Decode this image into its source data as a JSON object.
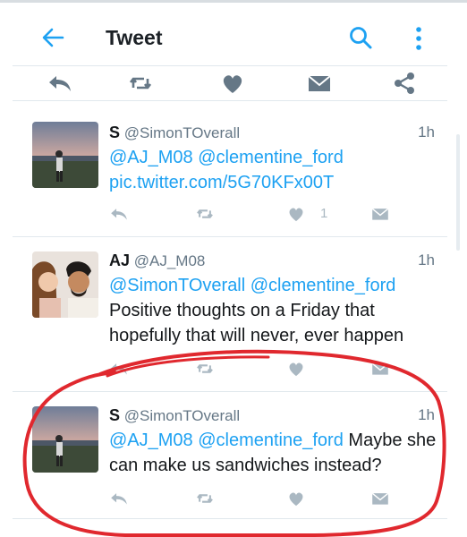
{
  "header": {
    "title": "Tweet",
    "back_icon": "arrow-left-icon",
    "search_icon": "search-icon",
    "more_icon": "more-vertical-icon"
  },
  "action_bar": [
    "reply-icon",
    "retweet-icon",
    "heart-icon",
    "message-icon",
    "share-icon"
  ],
  "tweets": [
    {
      "name": "S",
      "handle": "@SimonTOverall",
      "time": "1h",
      "mentions": "@AJ_M08 @clementine_ford",
      "link": "pic.twitter.com/5G70KFx00T",
      "likes": "1"
    },
    {
      "name": "AJ",
      "handle": "@AJ_M08",
      "time": "1h",
      "mentions": "@SimonTOverall @clementine_ford",
      "text": "Positive thoughts on a Friday that hopefully that will never, ever happen"
    },
    {
      "name": "S",
      "handle": "@SimonTOverall",
      "time": "1h",
      "mentions": "@AJ_M08 @clementine_ford",
      "text": "Maybe she can make us sandwiches instead?"
    }
  ],
  "colors": {
    "accent": "#1da1f2",
    "muted": "#657786",
    "icon_gray": "#aab8c2",
    "annotation_red": "#e0282e"
  }
}
